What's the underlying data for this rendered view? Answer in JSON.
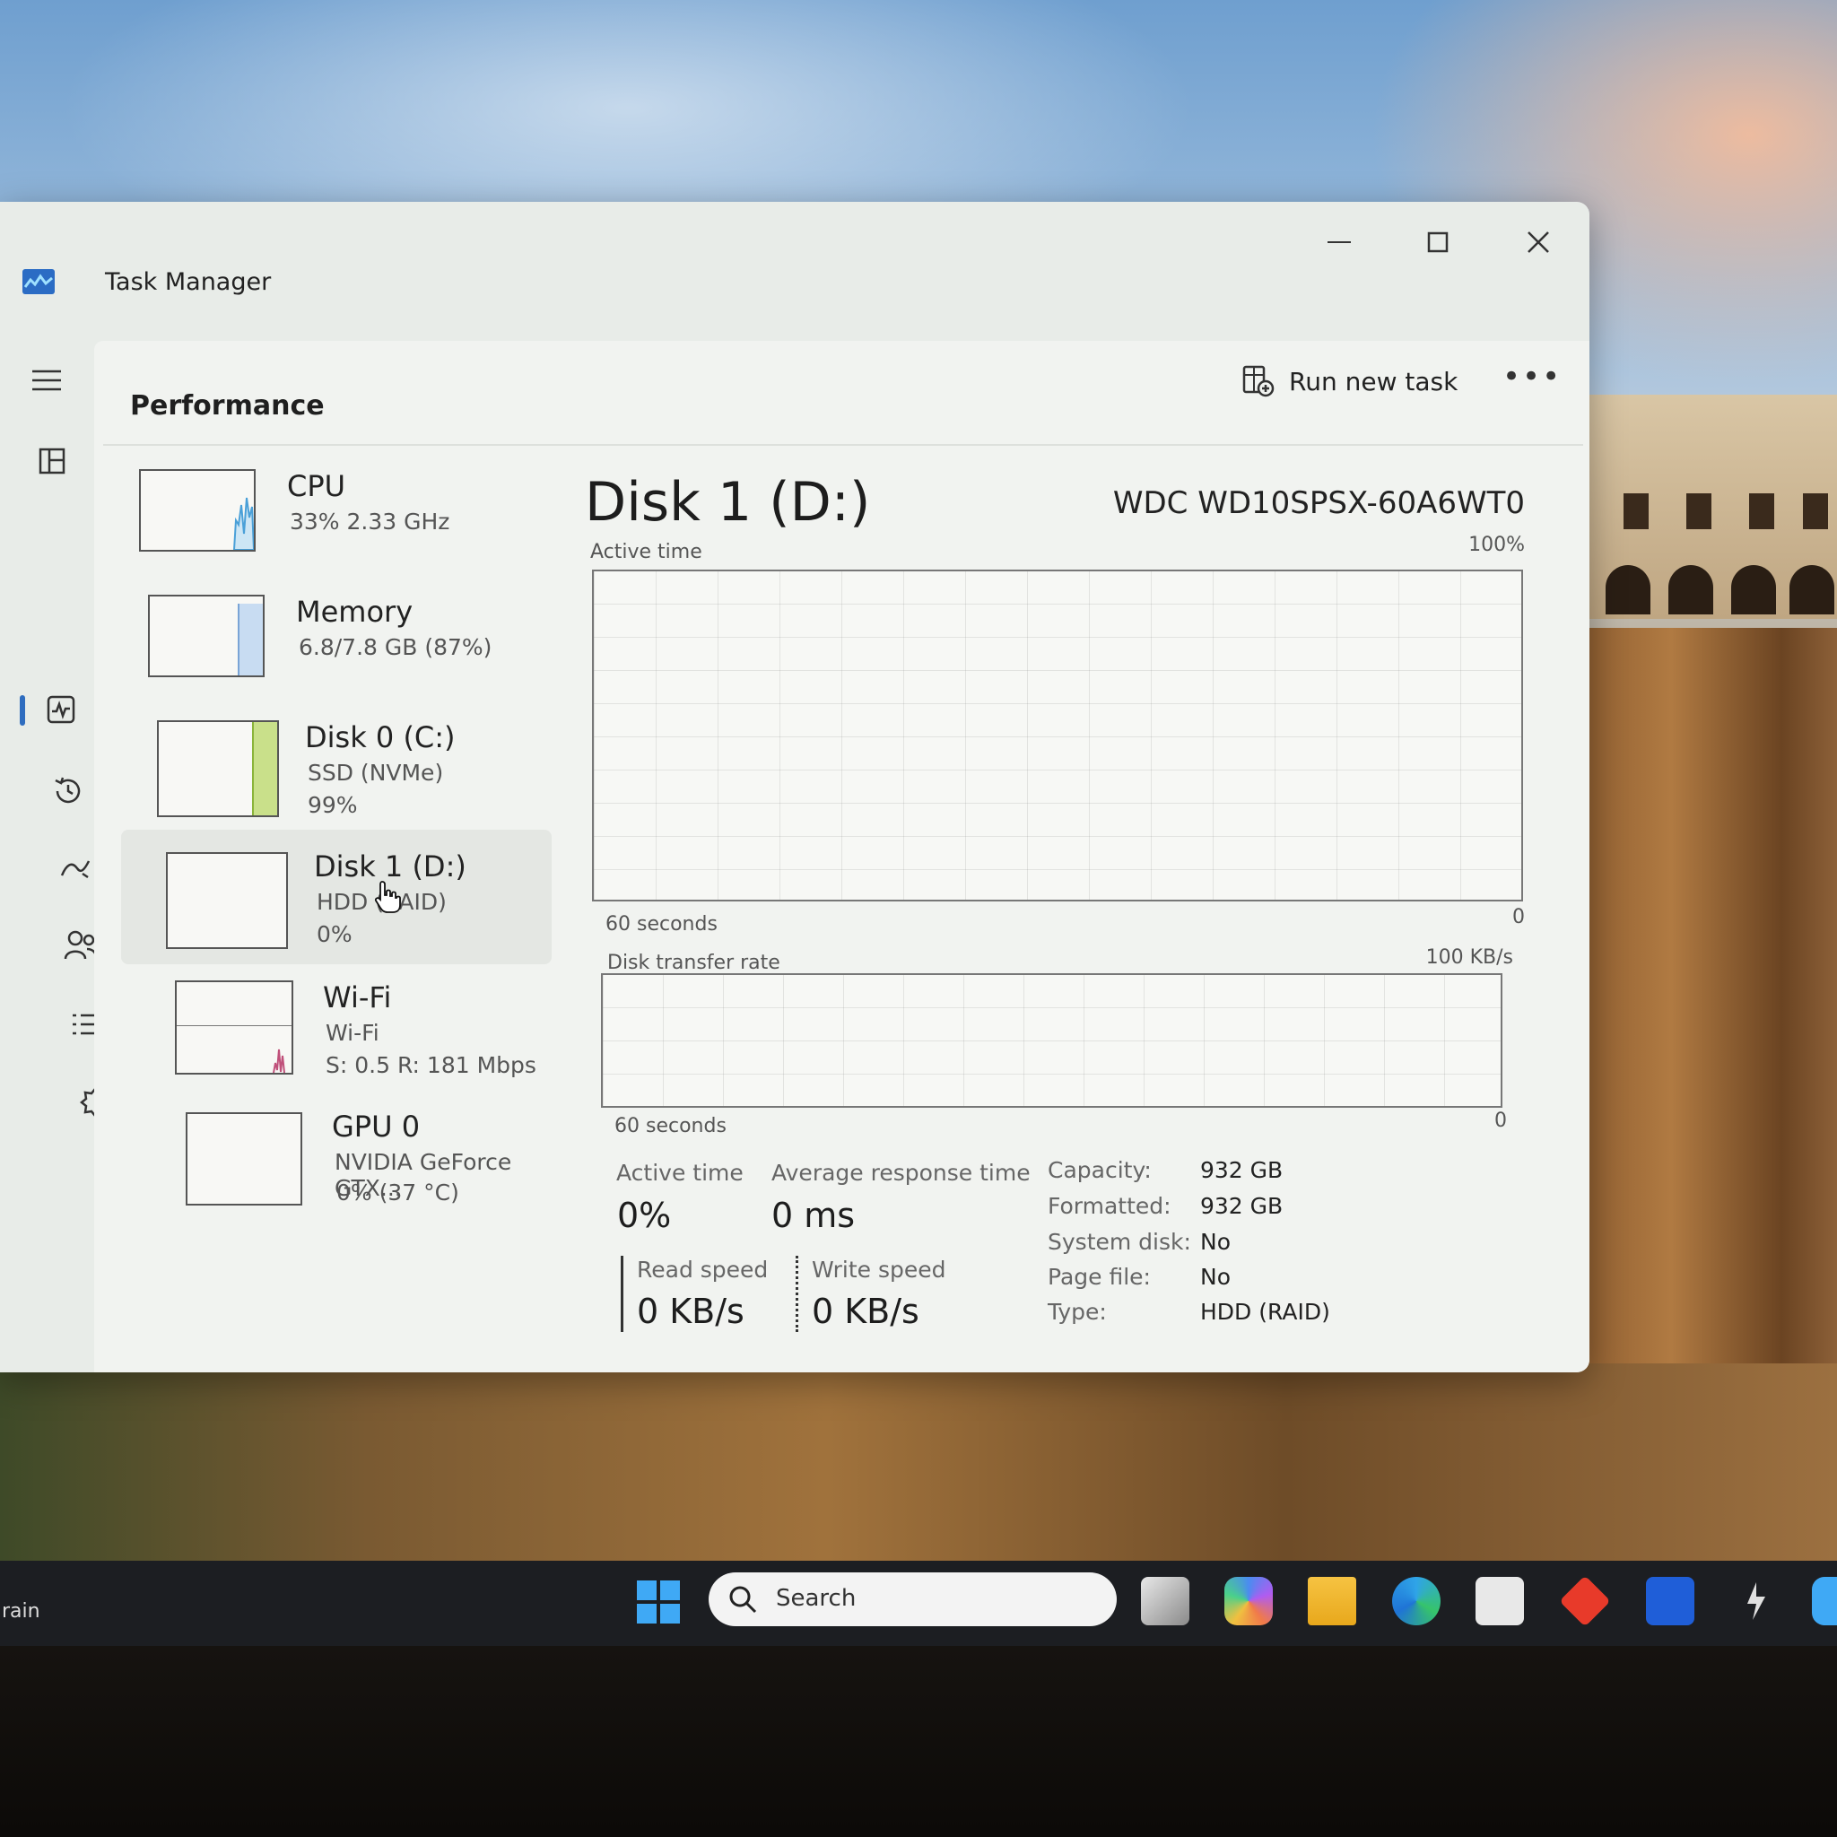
{
  "window": {
    "title": "Task Manager"
  },
  "page": {
    "title": "Performance",
    "run_new_task_label": "Run new task",
    "more_label": "•••"
  },
  "devices": [
    {
      "name": "CPU",
      "sub": "33%  2.33 GHz",
      "sub2": "",
      "color": "#4aa0d8"
    },
    {
      "name": "Memory",
      "sub": "6.8/7.8 GB (87%)",
      "sub2": "",
      "color": "#8ab4e0"
    },
    {
      "name": "Disk 0 (C:)",
      "sub": "SSD (NVMe)",
      "sub2": "99%",
      "color": "#9cc43c"
    },
    {
      "name": "Disk 1 (D:)",
      "sub": "HDD (RAID)",
      "sub2": "0%",
      "color": "#9cc43c"
    },
    {
      "name": "Wi-Fi",
      "sub": "Wi-Fi",
      "sub2": "S: 0.5  R: 181 Mbps",
      "color": "#c0507a"
    },
    {
      "name": "GPU 0",
      "sub": "NVIDIA GeForce GTX...",
      "sub2": "0%  (37 °C)",
      "color": "#7a7a7a"
    }
  ],
  "detail": {
    "title": "Disk 1 (D:)",
    "model": "WDC WD10SPSX-60A6WT0",
    "graph1": {
      "label": "Active time",
      "max": "100%",
      "duration": "60 seconds",
      "min": "0"
    },
    "graph2": {
      "label": "Disk transfer rate",
      "max": "100 KB/s",
      "duration": "60 seconds",
      "min": "0"
    },
    "stats": {
      "active_time_label": "Active time",
      "active_time_value": "0%",
      "avg_response_label": "Average response time",
      "avg_response_value": "0 ms",
      "read_speed_label": "Read speed",
      "read_speed_value": "0 KB/s",
      "write_speed_label": "Write speed",
      "write_speed_value": "0 KB/s"
    },
    "properties": [
      {
        "label": "Capacity:",
        "value": "932 GB"
      },
      {
        "label": "Formatted:",
        "value": "932 GB"
      },
      {
        "label": "System disk:",
        "value": "No"
      },
      {
        "label": "Page file:",
        "value": "No"
      },
      {
        "label": "Type:",
        "value": "HDD (RAID)"
      }
    ]
  },
  "taskbar": {
    "weather_text": "rain",
    "search_label": "Search"
  },
  "colors": {
    "accent": "#2f6dbf",
    "disk_green": "#9cc43c"
  }
}
